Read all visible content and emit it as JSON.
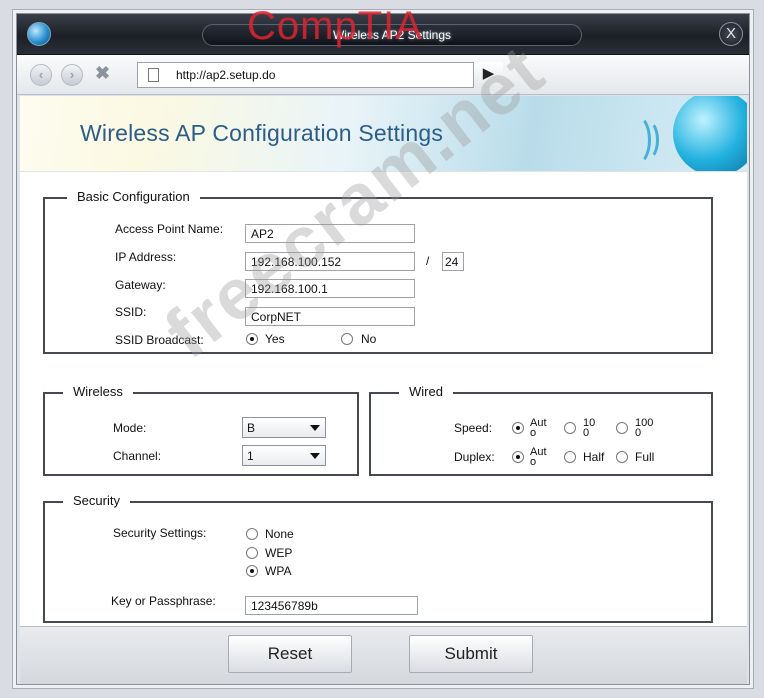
{
  "window": {
    "title": "Wireless AP2 Settings",
    "brand_watermark": "CompTIA",
    "close_label": "X"
  },
  "nav": {
    "url": "http://ap2.setup.do",
    "back_glyph": "‹",
    "forward_glyph": "›",
    "stop_glyph": "✖",
    "go_glyph": "▶"
  },
  "banner": {
    "title": "Wireless AP Configuration Settings"
  },
  "basic": {
    "legend": "Basic Configuration",
    "ap_name_label": "Access Point Name:",
    "ap_name_value": "AP2",
    "ip_label": "IP Address:",
    "ip_value": "192.168.100.152",
    "slash": "/",
    "mask_value": "24",
    "gateway_label": "Gateway:",
    "gateway_value": "192.168.100.1",
    "ssid_label": "SSID:",
    "ssid_value": "CorpNET",
    "broadcast_label": "SSID Broadcast:",
    "broadcast_yes": "Yes",
    "broadcast_no": "No",
    "broadcast_selected": "Yes"
  },
  "wireless": {
    "legend": "Wireless",
    "mode_label": "Mode:",
    "mode_value": "B",
    "channel_label": "Channel:",
    "channel_value": "1"
  },
  "wired": {
    "legend": "Wired",
    "speed_label": "Speed:",
    "speed_options": [
      "Aut o",
      "10 0",
      "100 0"
    ],
    "speed_selected": "Aut o",
    "duplex_label": "Duplex:",
    "duplex_options": [
      "Aut o",
      "Half",
      "Full"
    ],
    "duplex_selected": "Aut o"
  },
  "security": {
    "legend": "Security",
    "settings_label": "Security Settings:",
    "options": [
      "None",
      "WEP",
      "WPA"
    ],
    "selected": "WPA",
    "key_label": "Key or Passphrase:",
    "key_value": "123456789b"
  },
  "footer": {
    "reset_label": "Reset",
    "submit_label": "Submit"
  },
  "watermark": "freecram.net"
}
